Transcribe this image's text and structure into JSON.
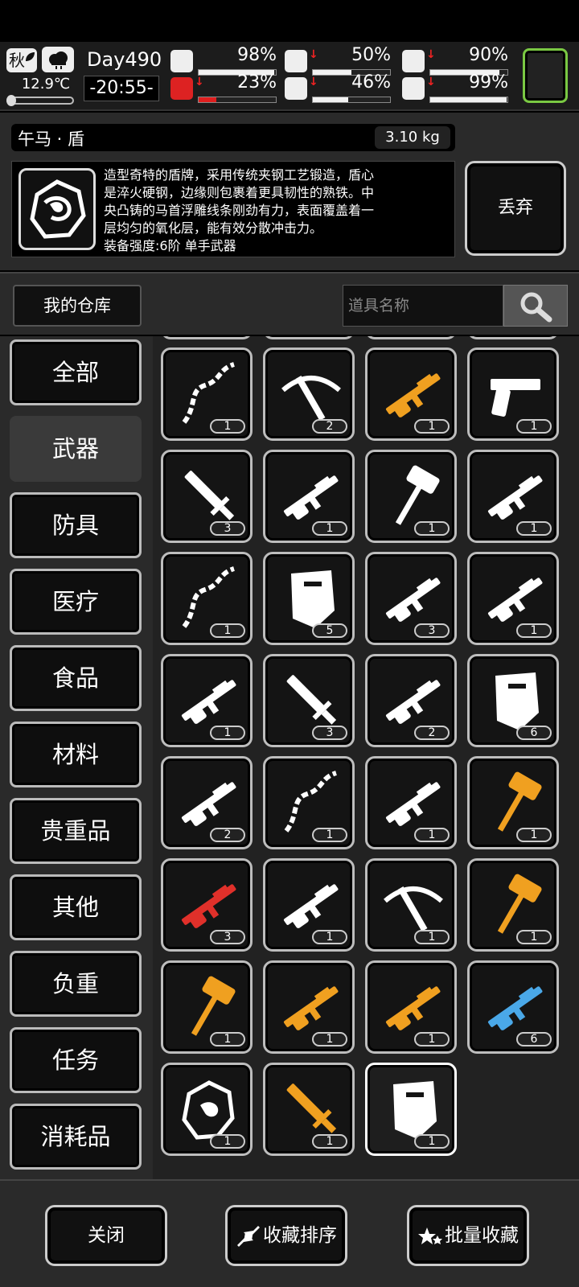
{
  "hud": {
    "season": "秋",
    "temperature": "12.9℃",
    "day": "Day490",
    "time": "-20:55-",
    "stats": [
      {
        "icon": "medkit-icon",
        "value": "98%",
        "level": 0.98,
        "down": false
      },
      {
        "icon": "stomach-icon",
        "value": "50%",
        "level": 0.5,
        "down": true
      },
      {
        "icon": "stamina-icon",
        "value": "90%",
        "level": 0.9,
        "down": true
      },
      {
        "icon": "leg-injury-icon",
        "value": "23%",
        "level": 0.23,
        "down": true
      },
      {
        "icon": "water-drop-icon",
        "value": "46%",
        "level": 0.46,
        "down": true
      },
      {
        "icon": "heart-icon",
        "value": "99%",
        "level": 0.99,
        "down": true
      }
    ]
  },
  "item": {
    "name": "午马 · 盾",
    "weight": "3.10 kg",
    "desc_lines": [
      "造型奇特的盾牌，采用传统夹钢工艺锻造，盾心",
      "是淬火硬钢，边缘则包裹着更具韧性的熟铁。中",
      "央凸铸的马首浮雕线条刚劲有力，表面覆盖着一",
      "层均匀的氧化层，能有效分散冲击力。",
      "装备强度:6阶 单手武器"
    ],
    "drop_label": "丢弃"
  },
  "warehouse": {
    "title": "我的仓库",
    "search_placeholder": "道具名称"
  },
  "categories": [
    "全部",
    "武器",
    "防具",
    "医疗",
    "食品",
    "材料",
    "贵重品",
    "其他",
    "负重",
    "任务",
    "消耗品"
  ],
  "active_category": "武器",
  "slots": [
    {
      "icon": "ornate-whip-icon",
      "qty": "1",
      "color": "#ffffff"
    },
    {
      "icon": "crossbow-icon",
      "qty": "2",
      "color": "#ffffff"
    },
    {
      "icon": "golden-blaster-icon",
      "qty": "1",
      "color": "#f0a020"
    },
    {
      "icon": "desert-eagle-icon",
      "qty": "1",
      "color": "#ffffff"
    },
    {
      "icon": "broadsword-icon",
      "qty": "3",
      "color": "#ffffff"
    },
    {
      "icon": "bolt-rifle-icon",
      "qty": "1",
      "color": "#ffffff"
    },
    {
      "icon": "axe-icon",
      "qty": "1",
      "color": "#ffffff"
    },
    {
      "icon": "hunting-rifle-icon",
      "qty": "1",
      "color": "#ffffff"
    },
    {
      "icon": "chain-whip-icon",
      "qty": "1",
      "color": "#ffffff"
    },
    {
      "icon": "armor-plate-icon",
      "qty": "5",
      "color": "#ffffff"
    },
    {
      "icon": "assault-rifle-icon",
      "qty": "3",
      "color": "#ffffff"
    },
    {
      "icon": "sawed-off-shotgun-icon",
      "qty": "1",
      "color": "#ffffff"
    },
    {
      "icon": "m16-rifle-icon",
      "qty": "1",
      "color": "#ffffff"
    },
    {
      "icon": "combat-knife-icon",
      "qty": "3",
      "color": "#ffffff"
    },
    {
      "icon": "sniper-rifle-icon",
      "qty": "2",
      "color": "#ffffff"
    },
    {
      "icon": "riot-shield-icon",
      "qty": "6",
      "color": "#ffffff"
    },
    {
      "icon": "pump-shotgun-icon",
      "qty": "2",
      "color": "#ffffff"
    },
    {
      "icon": "chainsaw-icon",
      "qty": "1",
      "color": "#ffffff"
    },
    {
      "icon": "grenade-launcher-icon",
      "qty": "1",
      "color": "#ffffff"
    },
    {
      "icon": "golden-hammer-icon",
      "qty": "1",
      "color": "#f0a020"
    },
    {
      "icon": "rpg-launcher-icon",
      "qty": "3",
      "color": "#e0302a"
    },
    {
      "icon": "dragon-gun-icon",
      "qty": "1",
      "color": "#ffffff"
    },
    {
      "icon": "heavy-crossbow-icon",
      "qty": "1",
      "color": "#ffffff"
    },
    {
      "icon": "war-hammer-icon",
      "qty": "1",
      "color": "#f0a020"
    },
    {
      "icon": "dragon-mace-icon",
      "qty": "1",
      "color": "#f0a020"
    },
    {
      "icon": "gold-smg-icon",
      "qty": "1",
      "color": "#f0a020"
    },
    {
      "icon": "gold-cannon-icon",
      "qty": "1",
      "color": "#f0a020"
    },
    {
      "icon": "gatling-gun-icon",
      "qty": "6",
      "color": "#4aa8e8"
    },
    {
      "icon": "bone-gauntlet-icon",
      "qty": "1",
      "color": "#ffffff"
    },
    {
      "icon": "gold-blade-icon",
      "qty": "1",
      "color": "#f0a020"
    },
    {
      "icon": "horse-shield-icon",
      "qty": "1",
      "color": "#ffffff"
    }
  ],
  "selected_slot": 30,
  "bottom": {
    "close_label": "关闭",
    "sort_label": "收藏排序",
    "batch_label": "批量收藏"
  }
}
